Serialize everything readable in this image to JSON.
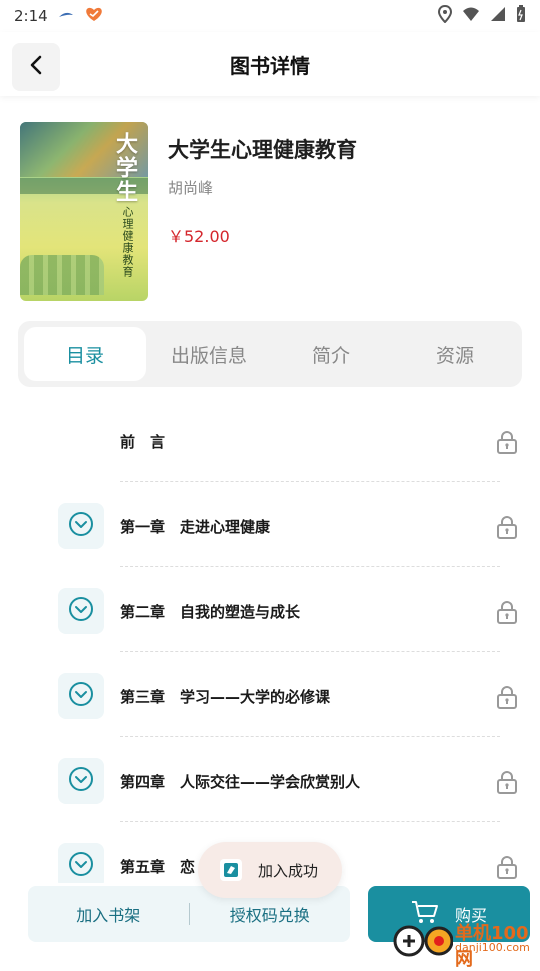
{
  "status_bar": {
    "time": "2:14"
  },
  "header": {
    "title": "图书详情"
  },
  "book": {
    "title": "大学生心理健康教育",
    "author": "胡尚峰",
    "price": "￥52.00",
    "cover_title": "大学生",
    "cover_subtitle": "心理健康教育"
  },
  "tabs": [
    {
      "label": "目录",
      "active": true
    },
    {
      "label": "出版信息",
      "active": false
    },
    {
      "label": "简介",
      "active": false
    },
    {
      "label": "资源",
      "active": false
    }
  ],
  "toc": [
    {
      "label": "前　言",
      "expandable": false
    },
    {
      "label": "第一章　走进心理健康",
      "expandable": true
    },
    {
      "label": "第二章　自我的塑造与成长",
      "expandable": true
    },
    {
      "label": "第三章　学习——大学的必修课",
      "expandable": true
    },
    {
      "label": "第四章　人际交往——学会欣赏别人",
      "expandable": true
    },
    {
      "label": "第五章　恋",
      "expandable": true
    }
  ],
  "actions": {
    "add_to_shelf": "加入书架",
    "redeem_code": "授权码兑换",
    "buy": "购买"
  },
  "toast": {
    "text": "加入成功"
  },
  "watermark": {
    "line1": "单机100网",
    "line2": "danji100.com"
  },
  "colors": {
    "accent": "#1a8fa0",
    "price": "#d4262c",
    "light_bg": "#eef6f8"
  }
}
